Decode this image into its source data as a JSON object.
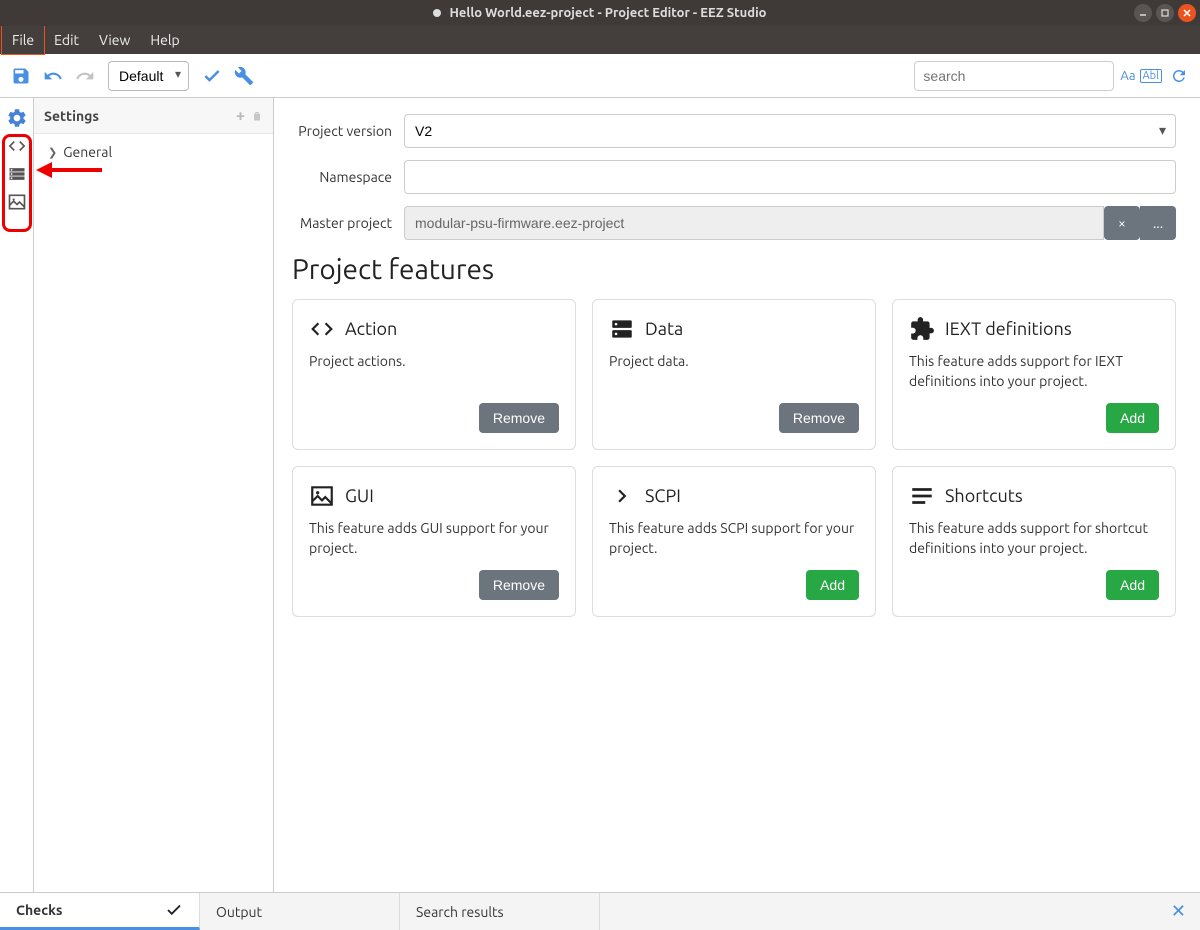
{
  "titlebar": {
    "text": "Hello World.eez-project - Project Editor - EEZ Studio"
  },
  "menubar": {
    "items": [
      "File",
      "Edit",
      "View",
      "Help"
    ]
  },
  "toolbar": {
    "layout_select": "Default",
    "search_placeholder": "search",
    "match_case": "Aa",
    "whole_word": "Abl"
  },
  "sidepanel": {
    "title": "Settings",
    "tree": {
      "item0": "General"
    }
  },
  "form": {
    "project_version_label": "Project version",
    "project_version_value": "V2",
    "namespace_label": "Namespace",
    "namespace_value": "",
    "master_label": "Master project",
    "master_value": "modular-psu-firmware.eez-project",
    "master_clear": "×",
    "master_more": "..."
  },
  "features": {
    "title": "Project features",
    "cards": [
      {
        "title": "Action",
        "desc": "Project actions.",
        "btn": "Remove",
        "btnType": "remove",
        "icon": "code"
      },
      {
        "title": "Data",
        "desc": "Project data.",
        "btn": "Remove",
        "btnType": "remove",
        "icon": "server"
      },
      {
        "title": "IEXT definitions",
        "desc": "This feature adds support for IEXT definitions into your project.",
        "btn": "Add",
        "btnType": "add",
        "icon": "puzzle"
      },
      {
        "title": "GUI",
        "desc": "This feature adds GUI support for your project.",
        "btn": "Remove",
        "btnType": "remove",
        "icon": "image"
      },
      {
        "title": "SCPI",
        "desc": "This feature adds SCPI support for your project.",
        "btn": "Add",
        "btnType": "add",
        "icon": "chevron"
      },
      {
        "title": "Shortcuts",
        "desc": "This feature adds support for shortcut definitions into your project.",
        "btn": "Add",
        "btnType": "add",
        "icon": "lines"
      }
    ]
  },
  "bottombar": {
    "tabs": [
      "Checks",
      "Output",
      "Search results"
    ]
  }
}
